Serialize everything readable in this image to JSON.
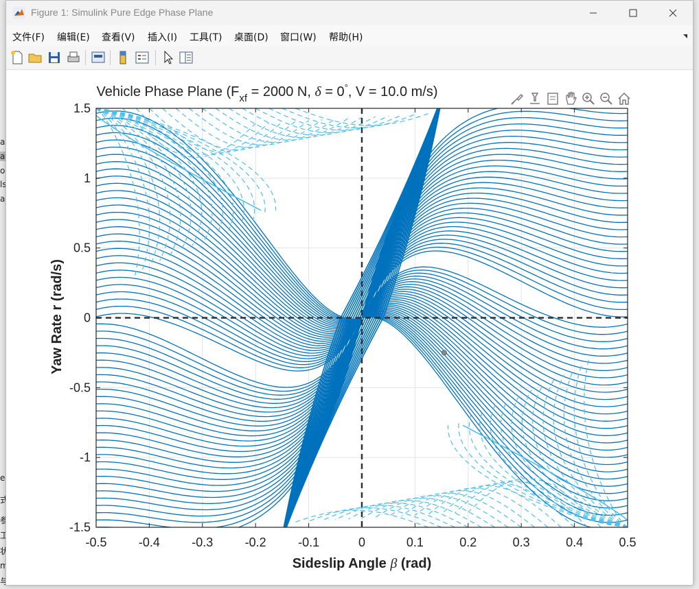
{
  "window": {
    "title": "Figure 1: Simulink Pure Edge Phase Plane"
  },
  "menu": [
    {
      "label": "文件(F)"
    },
    {
      "label": "编辑(E)"
    },
    {
      "label": "查看(V)"
    },
    {
      "label": "插入(I)"
    },
    {
      "label": "工具(T)"
    },
    {
      "label": "桌面(D)"
    },
    {
      "label": "窗口(W)"
    },
    {
      "label": "帮助(H)"
    }
  ],
  "toolbar": {
    "icons": [
      "new-figure-icon",
      "open-file-icon",
      "save-icon",
      "print-icon",
      "print-preview-icon",
      "colorbar-icon",
      "legend-icon",
      "select-pointer-icon",
      "property-inspector-icon"
    ]
  },
  "axes_toolbar": {
    "icons": [
      "brush-icon",
      "data-tips-icon",
      "pan-icon",
      "zoom-in-icon",
      "zoom-out-icon",
      "home-icon"
    ]
  },
  "colors": {
    "stable": "#0072bd",
    "unstable": "#4dbeee",
    "axis_dash": "#333333",
    "marker": "#7f8f85"
  },
  "chart_data": {
    "type": "line",
    "title": {
      "prefix": "Vehicle Phase Plane (F",
      "sub": "xf",
      "middle": " = 2000 N, ",
      "delta": "δ",
      "delta_val": " = 0",
      "deg": "°",
      "suffix": ", V = 10.0 m/s)"
    },
    "xlabel": {
      "pre": "Sideslip Angle ",
      "sym": "β",
      "post": " (rad)"
    },
    "ylabel": "Yaw Rate r (rad/s)",
    "xlim": [
      -0.5,
      0.5
    ],
    "ylim": [
      -1.5,
      1.5
    ],
    "xticks": [
      "-0.5",
      "-0.4",
      "-0.3",
      "-0.2",
      "-0.1",
      "0",
      "0.1",
      "0.2",
      "0.3",
      "0.4",
      "0.5"
    ],
    "yticks": [
      "1.5",
      "1",
      "0.5",
      "0",
      "-0.5",
      "-1",
      "-1.5"
    ],
    "grid": true,
    "series": [
      {
        "style": "solid",
        "color": "stable"
      },
      {
        "style": "dashed",
        "color": "unstable"
      }
    ],
    "reference_lines": [
      {
        "orientation": "vertical",
        "x": 0,
        "style": "dashed"
      },
      {
        "orientation": "horizontal",
        "y": 0,
        "style": "dashed"
      }
    ],
    "marker": {
      "x": 0.155,
      "y": -0.25
    }
  }
}
